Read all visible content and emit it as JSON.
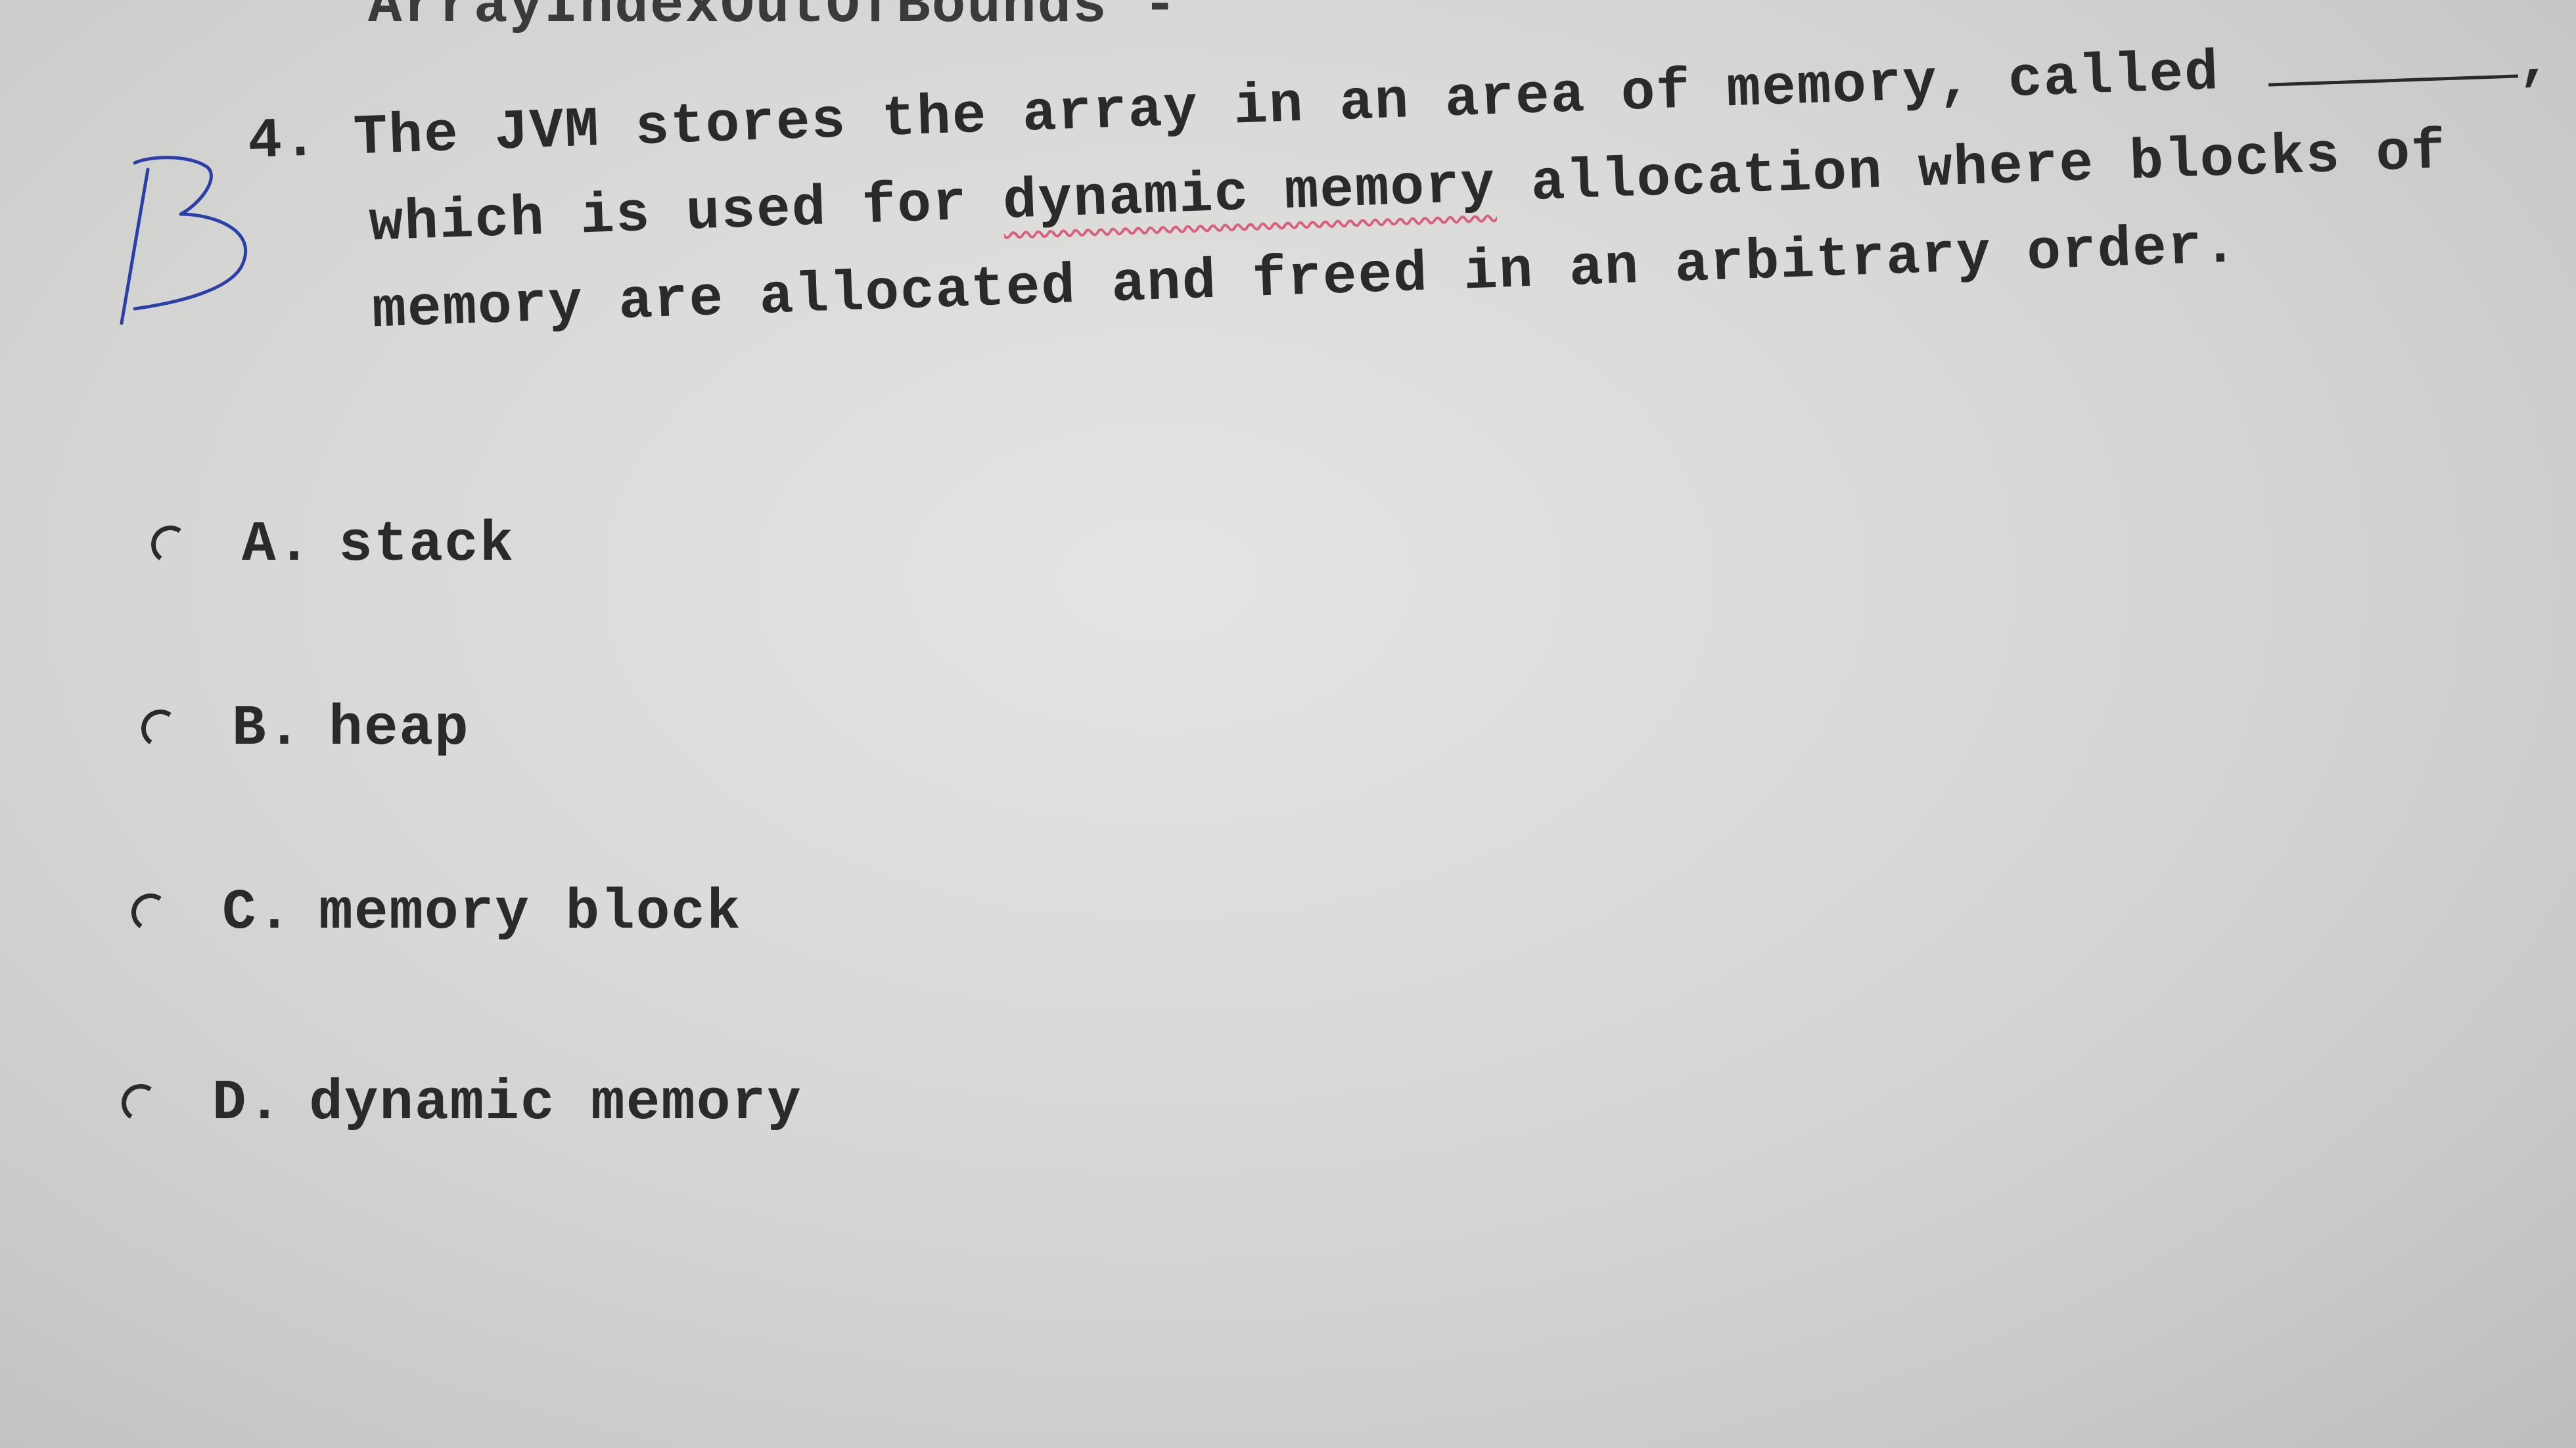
{
  "header_fragment": "ArrayIndexOutOfBounds  -",
  "question": {
    "number": "4.",
    "line1": "The JVM stores the array in an area of memory, called",
    "line1_suffix": ",",
    "line2_pre": "which is used for ",
    "line2_marked": "dynamic memory",
    "line2_post": " allocation where blocks of",
    "line3": "memory are allocated and freed in an arbitrary order."
  },
  "handwritten_answer": "B",
  "options": [
    {
      "letter": "A.",
      "text": "stack"
    },
    {
      "letter": "B.",
      "text": "heap"
    },
    {
      "letter": "C.",
      "text": "memory block"
    },
    {
      "letter": "D.",
      "text": "dynamic memory"
    }
  ],
  "colors": {
    "ink_pen": "#2a3fa8",
    "wavy_mark": "#d8607a",
    "print": "#2a2a2a"
  }
}
